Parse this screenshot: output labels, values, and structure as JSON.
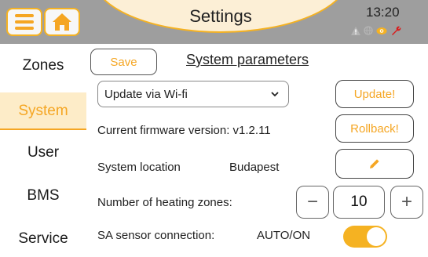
{
  "header": {
    "title": "Settings",
    "time": "13:20"
  },
  "status_icons": [
    "warning-icon",
    "globe-icon",
    "eye-icon",
    "wrench-icon"
  ],
  "sidebar": {
    "items": [
      {
        "label": "Zones"
      },
      {
        "label": "System",
        "active": true
      },
      {
        "label": "User"
      },
      {
        "label": "BMS"
      },
      {
        "label": "Service"
      }
    ]
  },
  "main": {
    "save_label": "Save",
    "section_title": "System parameters",
    "update_select": {
      "selected": "Update via Wi-fi"
    },
    "update_button": "Update!",
    "firmware_label": "Current firmware version: v1.2.11",
    "rollback_button": "Rollback!",
    "location_label": "System location",
    "location_value": "Budapest",
    "zones_label": "Number of heating zones:",
    "zones_value": "10",
    "minus_label": "−",
    "plus_label": "+",
    "sa_label": "SA sensor connection:",
    "sa_value": "AUTO/ON",
    "sa_toggle_on": true
  },
  "colors": {
    "accent": "#f5a623",
    "header_bg": "#fcefd6",
    "frame": "#9e9e9e"
  }
}
